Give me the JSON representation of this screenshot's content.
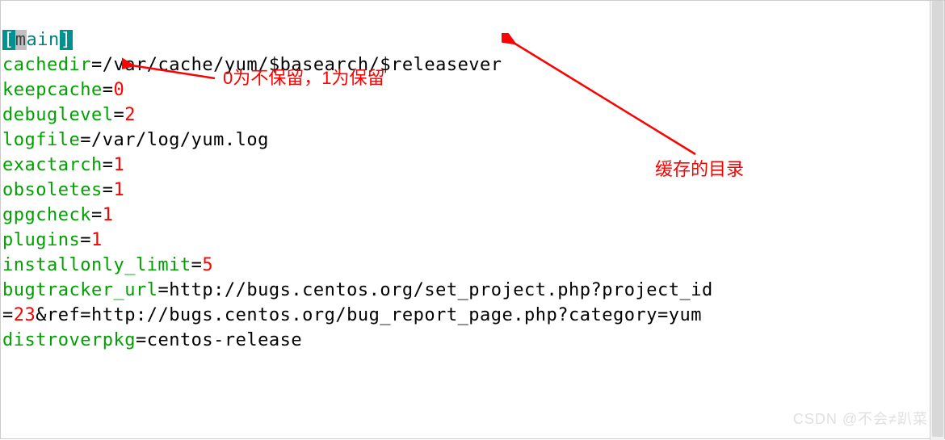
{
  "section": {
    "open_bracket": "[",
    "first_char": "m",
    "rest": "ain",
    "close_bracket": "]"
  },
  "lines": {
    "cachedir_key": "cachedir",
    "cachedir_eq": "=",
    "cachedir_val": "/var/cache/yum/$basearch/$releasever",
    "keepcache_key": "keepcache",
    "keepcache_eq": "=",
    "keepcache_val": "0",
    "debuglevel_key": "debuglevel",
    "debuglevel_eq": "=",
    "debuglevel_val": "2",
    "logfile_key": "logfile",
    "logfile_eq": "=",
    "logfile_val": "/var/log/yum.log",
    "exactarch_key": "exactarch",
    "exactarch_eq": "=",
    "exactarch_val": "1",
    "obsoletes_key": "obsoletes",
    "obsoletes_eq": "=",
    "obsoletes_val": "1",
    "gpgcheck_key": "gpgcheck",
    "gpgcheck_eq": "=",
    "gpgcheck_val": "1",
    "plugins_key": "plugins",
    "plugins_eq": "=",
    "plugins_val": "1",
    "installonly_key": "installonly_limit",
    "installonly_eq": "=",
    "installonly_val": "5",
    "bugtracker_key": "bugtracker_url",
    "bugtracker_eq": "=",
    "bugtracker_val1": "http://bugs.centos.org/set_project.php?project_id",
    "bugtracker_line2_eq": "=",
    "bugtracker_23": "23",
    "bugtracker_line2_rest": "&ref=http://bugs.centos.org/bug_report_page.php?category=yum",
    "distroverpkg_key": "distroverpkg",
    "distroverpkg_eq": "=",
    "distroverpkg_val": "centos-release"
  },
  "annotations": {
    "keepcache_note": "0为不保留，1为保留",
    "cachedir_note": "缓存的目录"
  },
  "watermark": "CSDN @不会≠趴菜"
}
